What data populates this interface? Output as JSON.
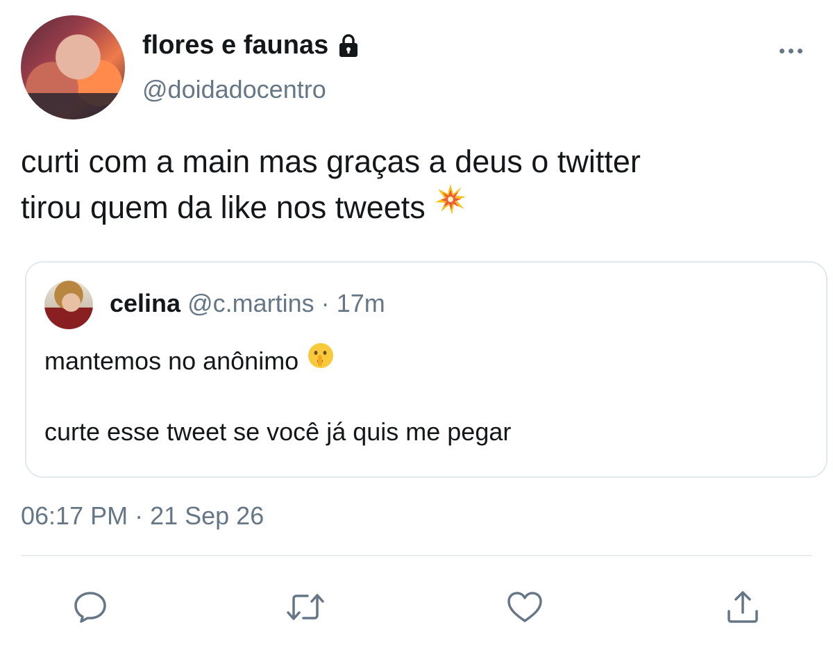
{
  "author": {
    "display_name": "flores e faunas",
    "handle": "@doidadocentro",
    "protected_icon": "lock-icon"
  },
  "tweet": {
    "lines": [
      "curti com a main mas graças a deus o twitter",
      "tirou quem da like nos tweets"
    ],
    "emoji": "collision-emoji"
  },
  "quoted": {
    "name": "celina",
    "handle": "@c.martins",
    "separator": "·",
    "time": "17m",
    "line1": "mantemos no anônimo",
    "line1_emoji": "shushing-face-emoji",
    "line2": "curte esse tweet se você já quis me pegar"
  },
  "timestamp": "06:17 PM · 21 Sep 26",
  "actions": {
    "reply_icon": "reply-icon",
    "retweet_icon": "retweet-icon",
    "like_icon": "heart-icon",
    "share_icon": "share-icon"
  },
  "colors": {
    "text": "#14171a",
    "secondary": "#657786",
    "border": "#e1e8ed",
    "icon": "#657786"
  }
}
